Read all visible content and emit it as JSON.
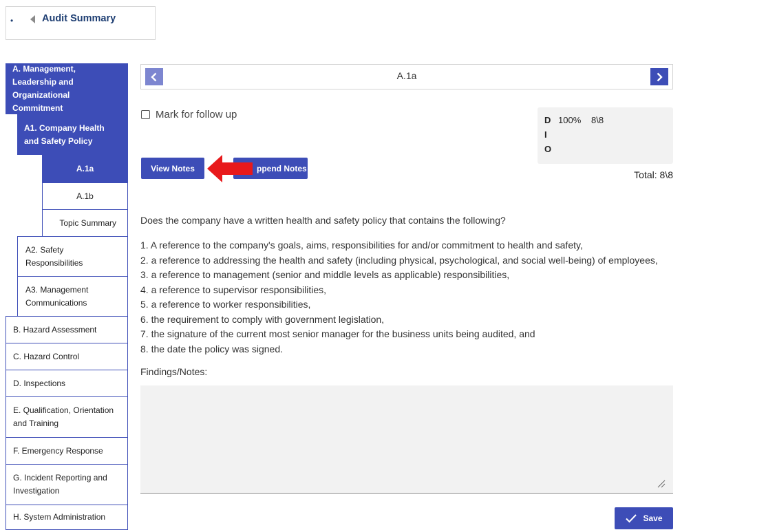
{
  "audit_summary": {
    "bullet": "•",
    "label": "Audit Summary"
  },
  "sidebar": {
    "items": [
      {
        "label": "A. Management, Leadership and Organizational Commitment"
      },
      {
        "label": "A1. Company Health and Safety Policy"
      },
      {
        "label": "A.1a"
      },
      {
        "label": "A.1b"
      },
      {
        "label": "Topic Summary"
      },
      {
        "label": "A2. Safety Responsibilities"
      },
      {
        "label": "A3. Management Communications"
      },
      {
        "label": "B. Hazard Assessment"
      },
      {
        "label": "C. Hazard Control"
      },
      {
        "label": "D. Inspections"
      },
      {
        "label": "E. Qualification, Orientation and Training"
      },
      {
        "label": "F. Emergency Response"
      },
      {
        "label": "G. Incident Reporting and Investigation"
      },
      {
        "label": "H. System Administration"
      }
    ]
  },
  "navigator": {
    "title": "A.1a"
  },
  "follow_up": {
    "label": "Mark for follow up"
  },
  "score": {
    "rows": [
      {
        "letter": "D",
        "percent": "100%",
        "ratio": "8\\8"
      },
      {
        "letter": "I",
        "percent": "",
        "ratio": ""
      },
      {
        "letter": "O",
        "percent": "",
        "ratio": ""
      }
    ],
    "total": "Total: 8\\8"
  },
  "buttons": {
    "view_notes": "View Notes",
    "append_notes": "ppend Notes",
    "save": "Save"
  },
  "question": {
    "text": "Does the company have a written health and safety policy that contains the following?",
    "requirements": [
      "1. A reference to the company's goals, aims, responsibilities for and/or commitment to health and safety,",
      "2. a reference to addressing the health and safety (including physical, psychological, and social well-being) of employees,",
      "3. a reference to management (senior and middle levels as applicable) responsibilities,",
      "4. a reference to supervisor responsibilities,",
      "5. a reference to worker responsibilities,",
      "6. the requirement to comply with government legislation,",
      "7. the signature of the current most senior manager for the business units being audited, and",
      "8. the date the policy was signed."
    ]
  },
  "findings": {
    "label": "Findings/Notes:",
    "value": ""
  },
  "colors": {
    "accent": "#3d4db7",
    "arrow": "#e8191b",
    "panel": "#f2f2f2"
  }
}
